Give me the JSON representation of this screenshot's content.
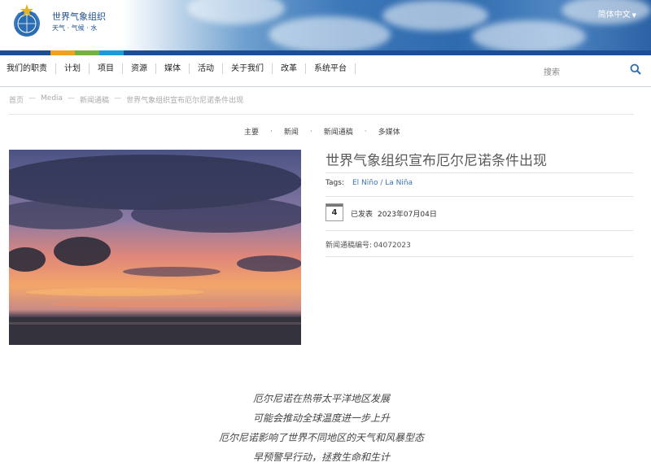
{
  "header": {
    "org_name": "世界气象组织",
    "org_sub": "天气 · 气候 · 水",
    "language": "简体中文"
  },
  "colorbar": [
    "#1a4f93",
    "#f0a21f",
    "#74b043",
    "#1d9bd6",
    "#1a4f93"
  ],
  "nav": {
    "items": [
      "我们的职责",
      "计划",
      "项目",
      "资源",
      "媒体",
      "活动",
      "关于我们",
      "改革",
      "系统平台"
    ],
    "search_label": "搜索"
  },
  "breadcrumb": [
    "首页",
    "Media",
    "新闻通稿",
    "世界气象组织宣布厄尔尼诺条件出现"
  ],
  "subnav": [
    "主要",
    "新闻",
    "新闻通稿",
    "多媒体"
  ],
  "article": {
    "title": "世界气象组织宣布厄尔尼诺条件出现",
    "tags_label": "Tags:",
    "tag": "El Niño / La Niña",
    "day": "4",
    "published_label": "已发表",
    "published_date": "2023年07月04日",
    "press_no_label": "新闻通稿编号:",
    "press_no": "04072023"
  },
  "highlights": [
    "厄尔尼诺在热带太平洋地区发展",
    "可能会推动全球温度进一步上升",
    "厄尔尼诺影响了世界不同地区的天气和风暴型态",
    "早预警早行动，拯救生命和生计"
  ]
}
